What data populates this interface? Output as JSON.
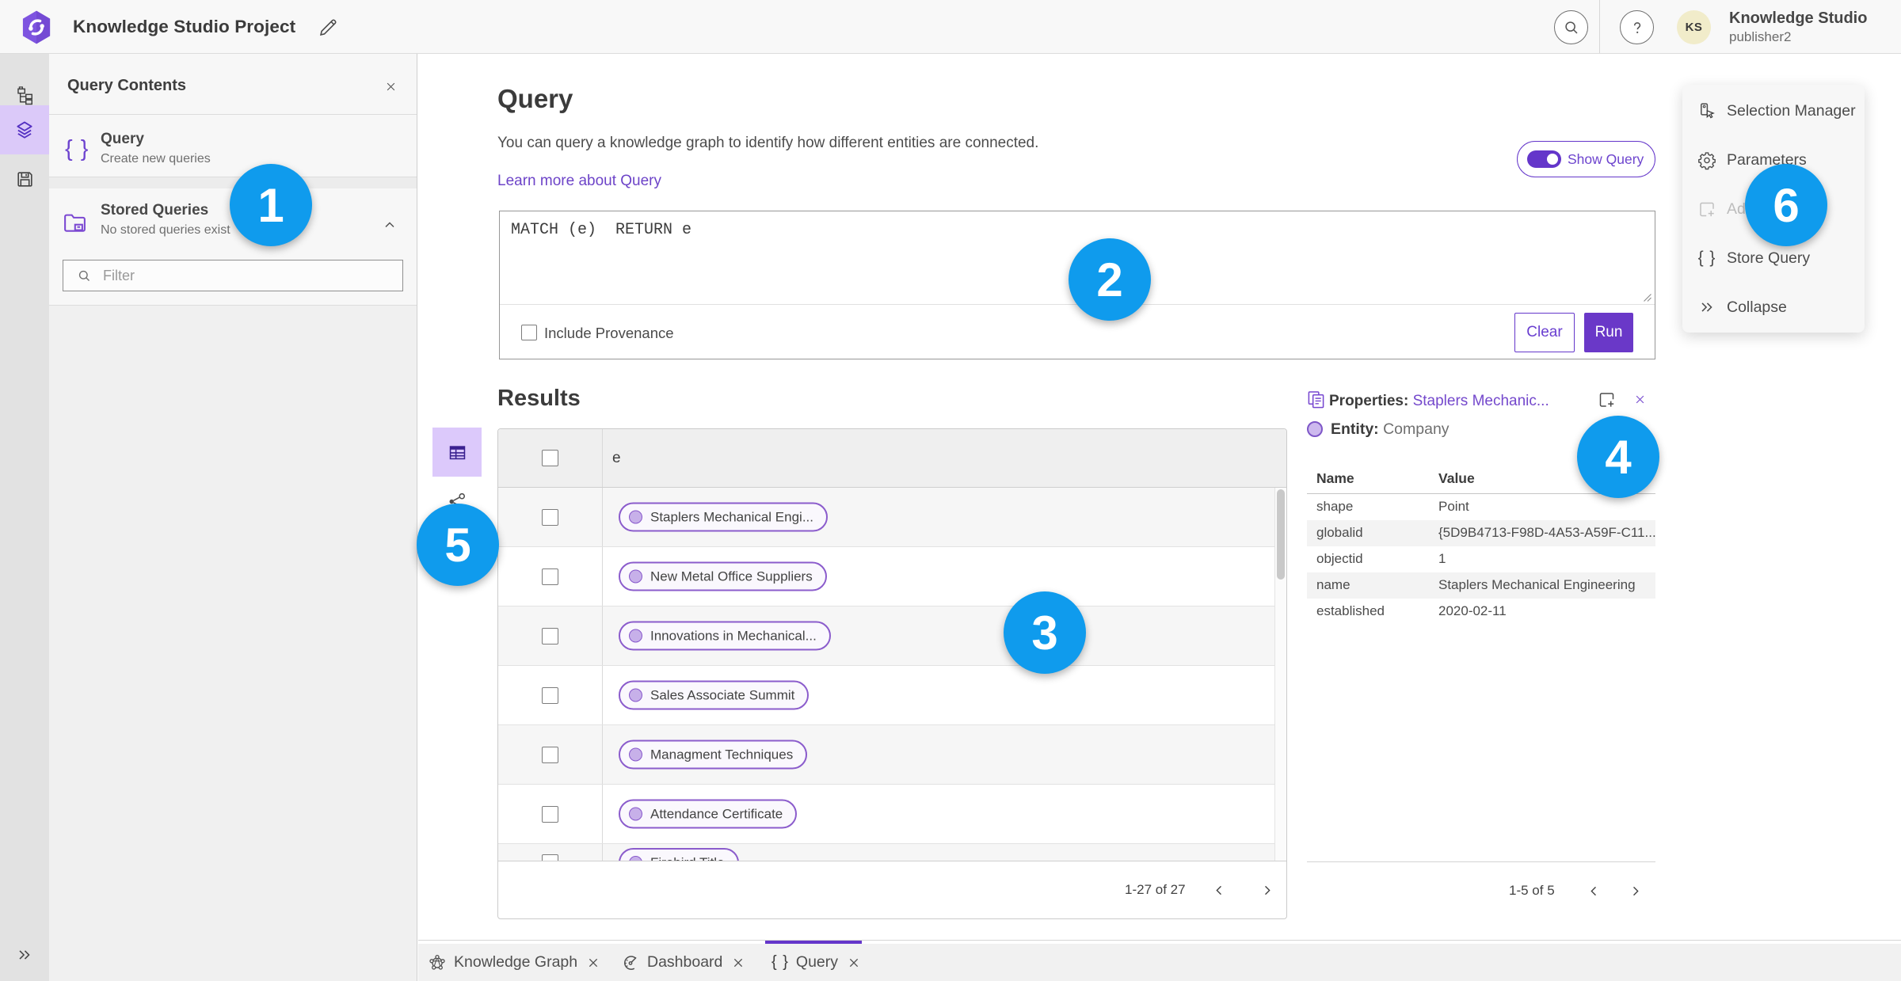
{
  "colors": {
    "accent_purple": "#6a38c8",
    "callout_blue": "#0f9bed"
  },
  "header": {
    "app_title": "Knowledge Studio Project",
    "user": {
      "initials": "KS",
      "name": "Knowledge Studio",
      "role": "publisher2"
    }
  },
  "sidebar_panel": {
    "title": "Query Contents",
    "query_item": {
      "title": "Query",
      "subtitle": "Create new queries",
      "icon": "{ }"
    },
    "stored_queries": {
      "title": "Stored Queries",
      "subtitle": "No stored queries exist"
    },
    "filter_placeholder": "Filter"
  },
  "query_section": {
    "title": "Query",
    "description": "You can query a knowledge graph to identify how different entities are connected.",
    "learn_more": "Learn more about Query",
    "show_query_label": "Show Query",
    "query_text": "MATCH (e)  RETURN e",
    "include_provenance_label": "Include Provenance",
    "clear_label": "Clear",
    "run_label": "Run"
  },
  "results": {
    "title": "Results",
    "column_header": "e",
    "rows": [
      {
        "label": "Staplers Mechanical Engi..."
      },
      {
        "label": "New Metal Office Suppliers"
      },
      {
        "label": "Innovations in Mechanical..."
      },
      {
        "label": "Sales Associate Summit"
      },
      {
        "label": "Managment Techniques"
      },
      {
        "label": "Attendance Certificate"
      },
      {
        "label": "Firebird Title"
      }
    ],
    "pagination": "1-27 of 27"
  },
  "properties_panel": {
    "title_prefix": "Properties:",
    "title_link": "Staplers Mechanic...",
    "entity_label": "Entity:",
    "entity_value": "Company",
    "columns": {
      "name": "Name",
      "value": "Value"
    },
    "rows": [
      {
        "name": "shape",
        "value": "Point"
      },
      {
        "name": "globalid",
        "value": "{5D9B4713-F98D-4A53-A59F-C11..."
      },
      {
        "name": "objectid",
        "value": "1"
      },
      {
        "name": "name",
        "value": "Staplers Mechanical Engineering"
      },
      {
        "name": "established",
        "value": "2020-02-11"
      }
    ],
    "pagination": "1-5 of 5"
  },
  "actions_panel": {
    "items": [
      {
        "label": "Selection Manager"
      },
      {
        "label": "Parameters"
      },
      {
        "label": "Add"
      },
      {
        "label": "Store Query",
        "icon": "{ }"
      },
      {
        "label": "Collapse"
      }
    ]
  },
  "tabs": [
    {
      "label": "Knowledge Graph"
    },
    {
      "label": "Dashboard"
    },
    {
      "label": "Query",
      "icon": "{ }"
    }
  ],
  "callouts": [
    {
      "n": "1"
    },
    {
      "n": "2"
    },
    {
      "n": "3"
    },
    {
      "n": "4"
    },
    {
      "n": "5"
    },
    {
      "n": "6"
    }
  ]
}
